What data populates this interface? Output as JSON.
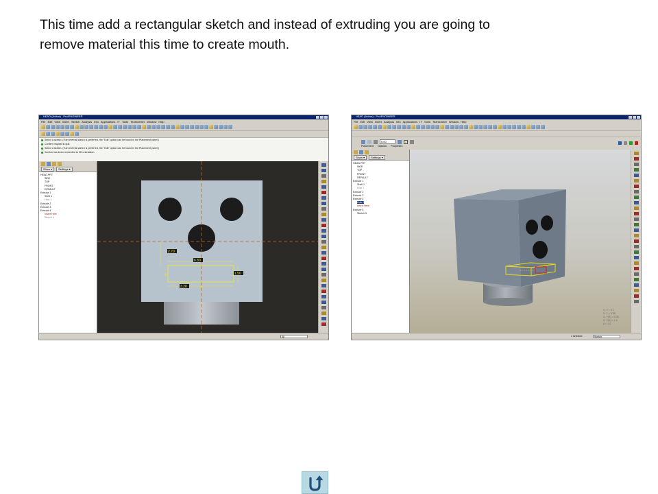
{
  "instruction": {
    "line1": "This time add a rectangular sketch and instead of extruding you are going to",
    "line2": "remove material this time to create mouth."
  },
  "left_screenshot": {
    "window_title": "HEAD (Active) - Pro/ENGINEER",
    "menus": [
      "File",
      "Edit",
      "View",
      "Insert",
      "Sketch",
      "Analysis",
      "Info",
      "Applications",
      "IT",
      "Tools",
      "Teamcenter",
      "Window",
      "Help"
    ],
    "messages": [
      "Select a sketch. (If an internal sketch is preferred, the \"Edit\" option can be found in the Placement panel.)",
      "Confirm request to quit.",
      "Select a sketch. (If an internal sketch is preferred, the \"Edit\" option can be found in the Placement panel.)",
      "Section has been reoriented to 2D orientation."
    ],
    "panel_buttons": {
      "show": "Show ▾",
      "settings": "Settings ▾"
    },
    "tree": [
      {
        "text": "HEAD.PRT",
        "style": "normal",
        "indent": 0
      },
      {
        "text": "SIDE",
        "style": "normal",
        "indent": 1
      },
      {
        "text": "TOP",
        "style": "normal",
        "indent": 1
      },
      {
        "text": "FRONT",
        "style": "normal",
        "indent": 1
      },
      {
        "text": "DEFAULT",
        "style": "normal",
        "indent": 1
      },
      {
        "text": "Extrude 1",
        "style": "normal",
        "indent": 0
      },
      {
        "text": "Shell 1",
        "style": "normal",
        "indent": 1
      },
      {
        "text": "Hole 1",
        "style": "gray",
        "indent": 1
      },
      {
        "text": "Extrude 2",
        "style": "normal",
        "indent": 0
      },
      {
        "text": "Extrude 3",
        "style": "normal",
        "indent": 0
      },
      {
        "text": "Extrude 4",
        "style": "normal",
        "indent": 0
      },
      {
        "text": "Insert Here",
        "style": "insert",
        "indent": 1
      },
      {
        "text": "Sketch 4",
        "style": "gray",
        "indent": 1
      }
    ],
    "dimensions": {
      "top": "6.80",
      "left": "2.70",
      "right": "1.50",
      "bottom": "3.20"
    },
    "status_filter": "All"
  },
  "right_screenshot": {
    "window_title": "HEAD (Active) - Pro/ENGINEER",
    "menus": [
      "File",
      "Edit",
      "View",
      "Insert",
      "Analysis",
      "Info",
      "Applications",
      "IT",
      "Tools",
      "Teamcenter",
      "Window",
      "Help"
    ],
    "dashboard_tabs": [
      "Placement",
      "Options",
      "Properties"
    ],
    "depth_value": "5.00",
    "panel_buttons": {
      "show": "Show ▾",
      "settings": "Settings ▾"
    },
    "tree": [
      {
        "text": "HEAD.PRT",
        "style": "normal",
        "indent": 0
      },
      {
        "text": "SIDE",
        "style": "normal",
        "indent": 1
      },
      {
        "text": "TOP",
        "style": "normal",
        "indent": 1
      },
      {
        "text": "FRONT",
        "style": "normal",
        "indent": 1
      },
      {
        "text": "DEFAULT",
        "style": "normal",
        "indent": 1
      },
      {
        "text": "Extrude 1",
        "style": "normal",
        "indent": 0
      },
      {
        "text": "Shell 1",
        "style": "normal",
        "indent": 1
      },
      {
        "text": "Hole 1",
        "style": "gray",
        "indent": 1
      },
      {
        "text": "Extrude 2",
        "style": "normal",
        "indent": 0
      },
      {
        "text": "Extrude 3",
        "style": "normal",
        "indent": 0
      },
      {
        "text": "Extrude 4",
        "style": "normal",
        "indent": 0
      },
      {
        "text": "Hole 2",
        "style": "highlight",
        "indent": 1
      },
      {
        "text": "Insert Here",
        "style": "insert",
        "indent": 1
      },
      {
        "text": "Extrude 5",
        "style": "normal",
        "indent": 0
      },
      {
        "text": "Sketch 5",
        "style": "normal",
        "indent": 1
      }
    ],
    "coords": [
      "X, Y = 6.1",
      "X, Y = 3.55",
      "X, Y(S) = 0.35",
      "X, Y(S) = 1.5",
      "A = 1.0"
    ],
    "status_selected": "1 selected",
    "status_filter": "Sketch"
  },
  "nav_button": {
    "icon": "return-arrow-icon",
    "label": "U-turn"
  }
}
